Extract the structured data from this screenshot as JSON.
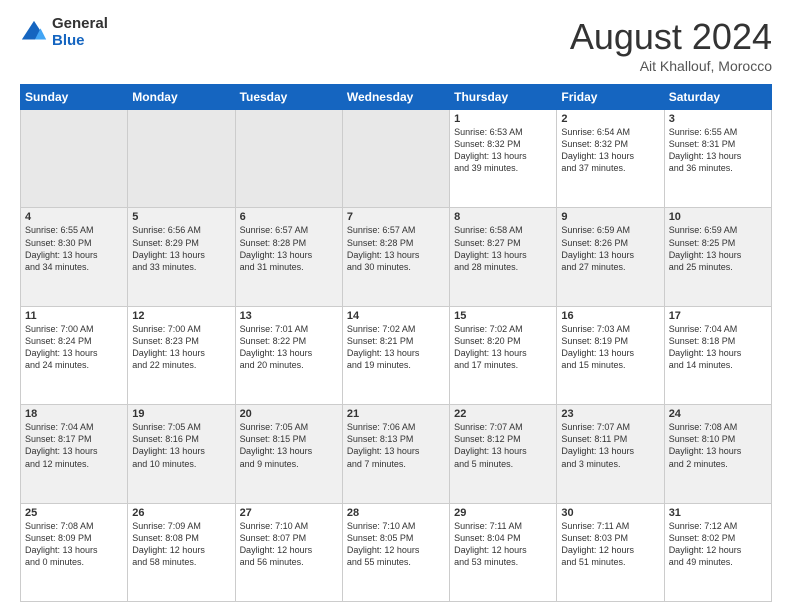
{
  "logo": {
    "general": "General",
    "blue": "Blue"
  },
  "title": {
    "month_year": "August 2024",
    "location": "Ait Khallouf, Morocco"
  },
  "headers": [
    "Sunday",
    "Monday",
    "Tuesday",
    "Wednesday",
    "Thursday",
    "Friday",
    "Saturday"
  ],
  "weeks": [
    [
      {
        "day": "",
        "content": ""
      },
      {
        "day": "",
        "content": ""
      },
      {
        "day": "",
        "content": ""
      },
      {
        "day": "",
        "content": ""
      },
      {
        "day": "1",
        "content": "Sunrise: 6:53 AM\nSunset: 8:32 PM\nDaylight: 13 hours\nand 39 minutes."
      },
      {
        "day": "2",
        "content": "Sunrise: 6:54 AM\nSunset: 8:32 PM\nDaylight: 13 hours\nand 37 minutes."
      },
      {
        "day": "3",
        "content": "Sunrise: 6:55 AM\nSunset: 8:31 PM\nDaylight: 13 hours\nand 36 minutes."
      }
    ],
    [
      {
        "day": "4",
        "content": "Sunrise: 6:55 AM\nSunset: 8:30 PM\nDaylight: 13 hours\nand 34 minutes."
      },
      {
        "day": "5",
        "content": "Sunrise: 6:56 AM\nSunset: 8:29 PM\nDaylight: 13 hours\nand 33 minutes."
      },
      {
        "day": "6",
        "content": "Sunrise: 6:57 AM\nSunset: 8:28 PM\nDaylight: 13 hours\nand 31 minutes."
      },
      {
        "day": "7",
        "content": "Sunrise: 6:57 AM\nSunset: 8:28 PM\nDaylight: 13 hours\nand 30 minutes."
      },
      {
        "day": "8",
        "content": "Sunrise: 6:58 AM\nSunset: 8:27 PM\nDaylight: 13 hours\nand 28 minutes."
      },
      {
        "day": "9",
        "content": "Sunrise: 6:59 AM\nSunset: 8:26 PM\nDaylight: 13 hours\nand 27 minutes."
      },
      {
        "day": "10",
        "content": "Sunrise: 6:59 AM\nSunset: 8:25 PM\nDaylight: 13 hours\nand 25 minutes."
      }
    ],
    [
      {
        "day": "11",
        "content": "Sunrise: 7:00 AM\nSunset: 8:24 PM\nDaylight: 13 hours\nand 24 minutes."
      },
      {
        "day": "12",
        "content": "Sunrise: 7:00 AM\nSunset: 8:23 PM\nDaylight: 13 hours\nand 22 minutes."
      },
      {
        "day": "13",
        "content": "Sunrise: 7:01 AM\nSunset: 8:22 PM\nDaylight: 13 hours\nand 20 minutes."
      },
      {
        "day": "14",
        "content": "Sunrise: 7:02 AM\nSunset: 8:21 PM\nDaylight: 13 hours\nand 19 minutes."
      },
      {
        "day": "15",
        "content": "Sunrise: 7:02 AM\nSunset: 8:20 PM\nDaylight: 13 hours\nand 17 minutes."
      },
      {
        "day": "16",
        "content": "Sunrise: 7:03 AM\nSunset: 8:19 PM\nDaylight: 13 hours\nand 15 minutes."
      },
      {
        "day": "17",
        "content": "Sunrise: 7:04 AM\nSunset: 8:18 PM\nDaylight: 13 hours\nand 14 minutes."
      }
    ],
    [
      {
        "day": "18",
        "content": "Sunrise: 7:04 AM\nSunset: 8:17 PM\nDaylight: 13 hours\nand 12 minutes."
      },
      {
        "day": "19",
        "content": "Sunrise: 7:05 AM\nSunset: 8:16 PM\nDaylight: 13 hours\nand 10 minutes."
      },
      {
        "day": "20",
        "content": "Sunrise: 7:05 AM\nSunset: 8:15 PM\nDaylight: 13 hours\nand 9 minutes."
      },
      {
        "day": "21",
        "content": "Sunrise: 7:06 AM\nSunset: 8:13 PM\nDaylight: 13 hours\nand 7 minutes."
      },
      {
        "day": "22",
        "content": "Sunrise: 7:07 AM\nSunset: 8:12 PM\nDaylight: 13 hours\nand 5 minutes."
      },
      {
        "day": "23",
        "content": "Sunrise: 7:07 AM\nSunset: 8:11 PM\nDaylight: 13 hours\nand 3 minutes."
      },
      {
        "day": "24",
        "content": "Sunrise: 7:08 AM\nSunset: 8:10 PM\nDaylight: 13 hours\nand 2 minutes."
      }
    ],
    [
      {
        "day": "25",
        "content": "Sunrise: 7:08 AM\nSunset: 8:09 PM\nDaylight: 13 hours\nand 0 minutes."
      },
      {
        "day": "26",
        "content": "Sunrise: 7:09 AM\nSunset: 8:08 PM\nDaylight: 12 hours\nand 58 minutes."
      },
      {
        "day": "27",
        "content": "Sunrise: 7:10 AM\nSunset: 8:07 PM\nDaylight: 12 hours\nand 56 minutes."
      },
      {
        "day": "28",
        "content": "Sunrise: 7:10 AM\nSunset: 8:05 PM\nDaylight: 12 hours\nand 55 minutes."
      },
      {
        "day": "29",
        "content": "Sunrise: 7:11 AM\nSunset: 8:04 PM\nDaylight: 12 hours\nand 53 minutes."
      },
      {
        "day": "30",
        "content": "Sunrise: 7:11 AM\nSunset: 8:03 PM\nDaylight: 12 hours\nand 51 minutes."
      },
      {
        "day": "31",
        "content": "Sunrise: 7:12 AM\nSunset: 8:02 PM\nDaylight: 12 hours\nand 49 minutes."
      }
    ]
  ]
}
